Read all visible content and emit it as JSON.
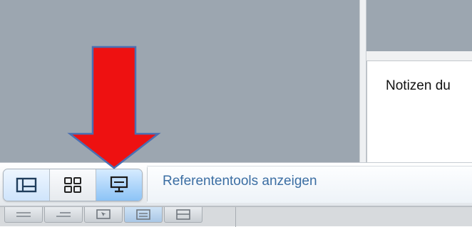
{
  "notes": {
    "text": "Notizen du"
  },
  "toolbar": {
    "buttons": [
      {
        "name": "normal-view-button",
        "icon": "normal-view-icon"
      },
      {
        "name": "slide-sorter-button",
        "icon": "slide-sorter-icon"
      },
      {
        "name": "presenter-tools-button",
        "icon": "presenter-monitor-icon"
      }
    ],
    "tooltip": "Referententools anzeigen"
  },
  "view_bar": {
    "icons": [
      "outline-view-icon",
      "text-lines-view-icon",
      "slide-view-icon",
      "notes-view-icon",
      "page-layout-view-icon"
    ]
  },
  "colors": {
    "arrow": "#ee1111",
    "arrow_outline": "#4a6fb2",
    "tooltip_text": "#3b6ea3",
    "slide_gray": "#9ca6b0"
  },
  "annotation": {
    "icon": "red-down-arrow"
  }
}
